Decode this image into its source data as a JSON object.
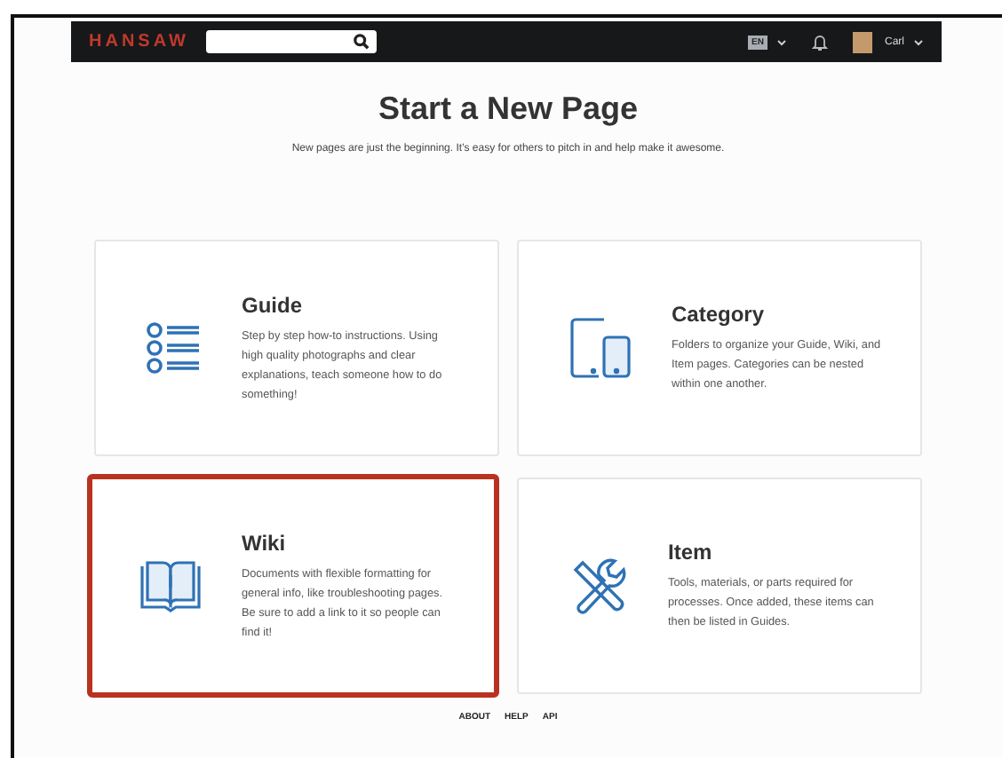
{
  "navbar": {
    "logo": "HANSAW",
    "language": "EN",
    "user": "Carl"
  },
  "heading": "Start a New Page",
  "subtitle": "New pages are just the beginning. It’s easy for others to pitch in and help make it awesome.",
  "cards": [
    {
      "kind": "guide",
      "title": "Guide",
      "description": "Step by step how-to instructions. Using high quality photographs and clear explanations, teach someone how to do something!",
      "selected": false
    },
    {
      "kind": "category",
      "title": "Category",
      "description": "Folders to organize your Guide, Wiki, and Item pages. Categories can be nested within one another.",
      "selected": false
    },
    {
      "kind": "wiki",
      "title": "Wiki",
      "description": "Documents with flexible formatting for general info, like troubleshooting pages. Be sure to add a link to it so people can find it!",
      "selected": true
    },
    {
      "kind": "item",
      "title": "Item",
      "description": "Tools, materials, or parts required for processes. Once added, these items can then be listed in Guides.",
      "selected": false
    }
  ],
  "footer_links": [
    "ABOUT",
    "HELP",
    "API"
  ]
}
